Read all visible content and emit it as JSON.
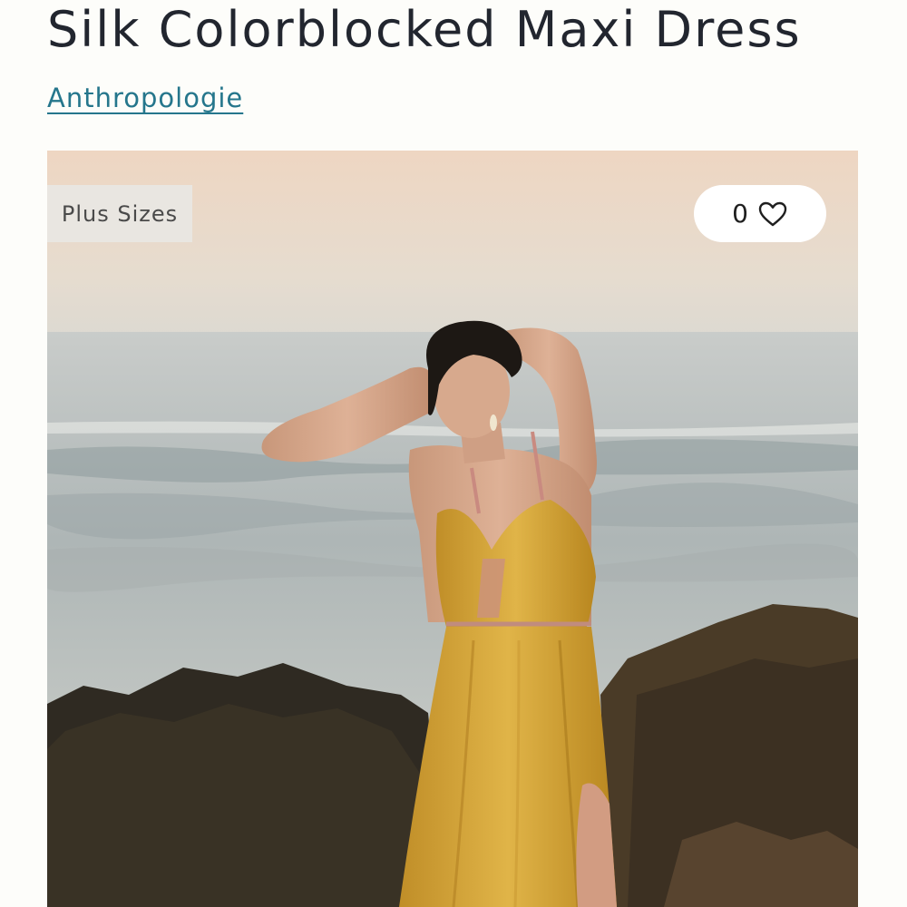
{
  "product": {
    "title": "Silk Colorblocked Maxi Dress",
    "brand": "Anthropologie"
  },
  "image": {
    "badge": "Plus Sizes",
    "like_count": "0",
    "like_icon": "heart-outline-icon",
    "alt": "Silk Colorblocked Maxi Dress"
  },
  "colors": {
    "title": "#22262f",
    "brand_link": "#25768c",
    "background": "#fdfdfa",
    "dress": "#d4a437"
  }
}
